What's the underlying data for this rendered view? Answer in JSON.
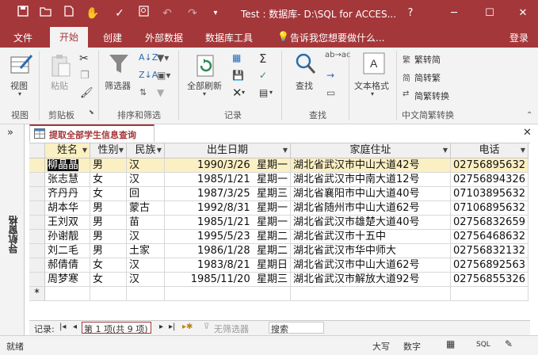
{
  "titlebar": {
    "title": "Test : 数据库- D:\\SQL for ACCES...",
    "help": "?",
    "minimize": "─",
    "maximize": "☐",
    "close": "✕"
  },
  "tabs": {
    "file": "文件",
    "home": "开始",
    "create": "创建",
    "external": "外部数据",
    "dbtools": "数据库工具",
    "tellme": "告诉我您想要做什么...",
    "signin": "登录"
  },
  "ribbon": {
    "view": "视图",
    "paste": "粘贴",
    "filter": "筛选器",
    "refresh_all": "全部刷新",
    "find": "查找",
    "text_format": "文本格式",
    "trad_to_simp": "繁转简",
    "simp_to_trad": "简转繁",
    "simp_trad_convert": "简繁转换",
    "groups": {
      "views": "视图",
      "clipboard": "剪贴板",
      "sort_filter": "排序和筛选",
      "records": "记录",
      "find": "查找",
      "chinese": "中文简繁转换"
    }
  },
  "nav_pane": {
    "label": "导航窗格",
    "toggle": "»"
  },
  "document": {
    "tab_label": "提取全部学生信息查询",
    "close": "✕"
  },
  "table": {
    "columns": [
      "姓名",
      "性别",
      "民族",
      "出生日期",
      "家庭住址",
      "电话"
    ],
    "rows": [
      [
        "柳晶晶",
        "男",
        "汉",
        "1990/3/26",
        "星期一",
        "湖北省武汉市中山大道42号",
        "02756895632"
      ],
      [
        "张志慧",
        "女",
        "汉",
        "1985/1/21",
        "星期一",
        "湖北省武汉市中南大道12号",
        "02756894326"
      ],
      [
        "齐丹丹",
        "女",
        "回",
        "1987/3/25",
        "星期三",
        "湖北省襄阳市中山大道40号",
        "07103895632"
      ],
      [
        "胡本华",
        "男",
        "蒙古",
        "1992/8/31",
        "星期一",
        "湖北省随州市中山大道62号",
        "07106895632"
      ],
      [
        "王刘双",
        "男",
        "苗",
        "1985/1/21",
        "星期一",
        "湖北省武汉市雄楚大道40号",
        "02756832659"
      ],
      [
        "孙谢靓",
        "男",
        "汉",
        "1995/5/23",
        "星期二",
        "湖北省武汉市十五中",
        "02756468632"
      ],
      [
        "刘二毛",
        "男",
        "土家",
        "1986/1/28",
        "星期二",
        "湖北省武汉市华中师大",
        "02756832132"
      ],
      [
        "郝倩倩",
        "女",
        "汉",
        "1983/8/21",
        "星期日",
        "湖北省武汉市中山大道62号",
        "02756892563"
      ],
      [
        "周梦寒",
        "女",
        "汉",
        "1985/11/20",
        "星期三",
        "湖北省武汉市解放大道92号",
        "02756855326"
      ]
    ],
    "new_row_marker": "*"
  },
  "record_nav": {
    "label": "记录:",
    "position": "第 1 项(共 9 项)",
    "no_filter": "无筛选器",
    "search": "搜索"
  },
  "status": {
    "ready": "就绪",
    "caps": "大写",
    "num": "数字",
    "sql": "SQL"
  },
  "colors": {
    "accent": "#a4373a",
    "selected_row": "#fbf0c3"
  }
}
